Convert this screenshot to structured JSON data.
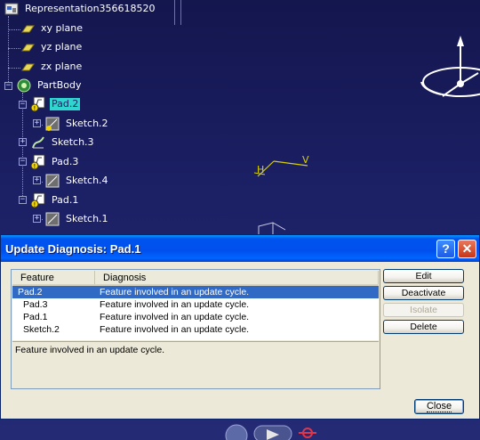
{
  "tree": {
    "root": "Representation356618520",
    "planes": [
      "xy plane",
      "yz plane",
      "zx plane"
    ],
    "body": "PartBody",
    "features": [
      {
        "label": "Pad.2",
        "child": "Sketch.2",
        "selected": true
      },
      {
        "label": "Sketch.3"
      },
      {
        "label": "Pad.3",
        "child": "Sketch.4"
      },
      {
        "label": "Pad.1",
        "child": "Sketch.1"
      }
    ]
  },
  "sketch_axes": {
    "h": "H",
    "v": "V"
  },
  "dialog": {
    "title": "Update Diagnosis: Pad.1",
    "help_label": "?",
    "close_x_label": "✕",
    "columns": [
      "Feature",
      "Diagnosis"
    ],
    "rows": [
      {
        "feature": "Pad.2",
        "diagnosis": "Feature involved in an update cycle."
      },
      {
        "feature": "Pad.3",
        "diagnosis": "Feature involved in an update cycle."
      },
      {
        "feature": "Pad.1",
        "diagnosis": "Feature involved in an update cycle."
      },
      {
        "feature": "Sketch.2",
        "diagnosis": "Feature involved in an update cycle."
      }
    ],
    "message": "Feature involved in an update cycle.",
    "buttons": {
      "edit": "Edit",
      "deactivate": "Deactivate",
      "isolate": "Isolate",
      "delete": "Delete",
      "close": "Close"
    }
  },
  "colors": {
    "background": "#1b1f63",
    "selection": "#316ac5",
    "tree_highlight": "#2fd6d0",
    "sketch_axis": "#d9d000"
  }
}
